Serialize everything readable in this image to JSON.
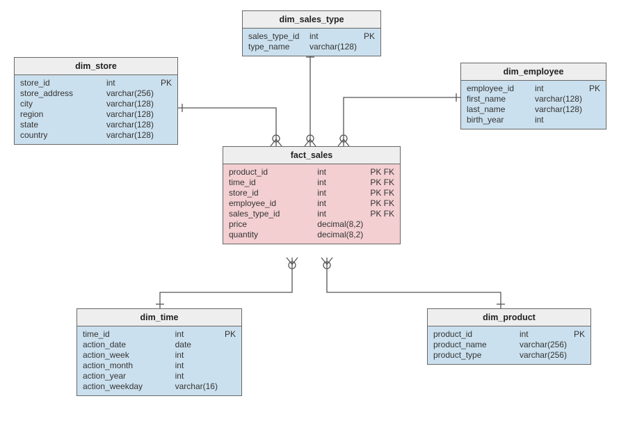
{
  "entities": {
    "dim_sales_type": {
      "title": "dim_sales_type",
      "columns": [
        {
          "name": "sales_type_id",
          "type": "int",
          "key": "PK"
        },
        {
          "name": "type_name",
          "type": "varchar(128)",
          "key": ""
        }
      ]
    },
    "dim_store": {
      "title": "dim_store",
      "columns": [
        {
          "name": "store_id",
          "type": "int",
          "key": "PK"
        },
        {
          "name": "store_address",
          "type": "varchar(256)",
          "key": ""
        },
        {
          "name": "city",
          "type": "varchar(128)",
          "key": ""
        },
        {
          "name": "region",
          "type": "varchar(128)",
          "key": ""
        },
        {
          "name": "state",
          "type": "varchar(128)",
          "key": ""
        },
        {
          "name": "country",
          "type": "varchar(128)",
          "key": ""
        }
      ]
    },
    "dim_employee": {
      "title": "dim_employee",
      "columns": [
        {
          "name": "employee_id",
          "type": "int",
          "key": "PK"
        },
        {
          "name": "first_name",
          "type": "varchar(128)",
          "key": ""
        },
        {
          "name": "last_name",
          "type": "varchar(128)",
          "key": ""
        },
        {
          "name": "birth_year",
          "type": "int",
          "key": ""
        }
      ]
    },
    "fact_sales": {
      "title": "fact_sales",
      "columns": [
        {
          "name": "product_id",
          "type": "int",
          "key": "PK FK"
        },
        {
          "name": "time_id",
          "type": "int",
          "key": "PK FK"
        },
        {
          "name": "store_id",
          "type": "int",
          "key": "PK FK"
        },
        {
          "name": "employee_id",
          "type": "int",
          "key": "PK FK"
        },
        {
          "name": "sales_type_id",
          "type": "int",
          "key": "PK FK"
        },
        {
          "name": "price",
          "type": "decimal(8,2)",
          "key": ""
        },
        {
          "name": "quantity",
          "type": "decimal(8,2)",
          "key": ""
        }
      ]
    },
    "dim_time": {
      "title": "dim_time",
      "columns": [
        {
          "name": "time_id",
          "type": "int",
          "key": "PK"
        },
        {
          "name": "action_date",
          "type": "date",
          "key": ""
        },
        {
          "name": "action_week",
          "type": "int",
          "key": ""
        },
        {
          "name": "action_month",
          "type": "int",
          "key": ""
        },
        {
          "name": "action_year",
          "type": "int",
          "key": ""
        },
        {
          "name": "action_weekday",
          "type": "varchar(16)",
          "key": ""
        }
      ]
    },
    "dim_product": {
      "title": "dim_product",
      "columns": [
        {
          "name": "product_id",
          "type": "int",
          "key": "PK"
        },
        {
          "name": "product_name",
          "type": "varchar(256)",
          "key": ""
        },
        {
          "name": "product_type",
          "type": "varchar(256)",
          "key": ""
        }
      ]
    }
  },
  "colors": {
    "dim_fill": "#cbe0ee",
    "fact_fill": "#f3cfd2",
    "header_fill": "#eeeeee",
    "border": "#666666"
  }
}
